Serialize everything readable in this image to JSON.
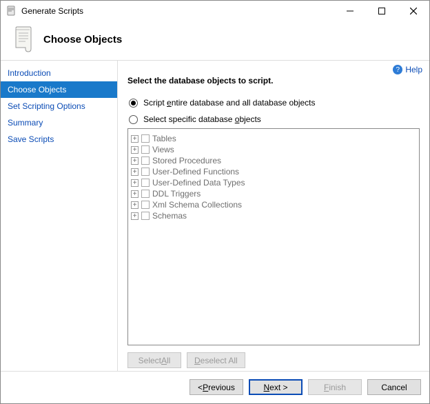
{
  "window": {
    "title": "Generate Scripts"
  },
  "header": {
    "title": "Choose Objects"
  },
  "sidebar": {
    "items": [
      {
        "label": "Introduction"
      },
      {
        "label": "Choose Objects"
      },
      {
        "label": "Set Scripting Options"
      },
      {
        "label": "Summary"
      },
      {
        "label": "Save Scripts"
      }
    ],
    "active_index": 1
  },
  "help": {
    "label": "Help"
  },
  "main": {
    "instruction": "Select the database objects to script.",
    "radios": {
      "entire_pre": "Script ",
      "entire_u": "e",
      "entire_post": "ntire database and all database objects",
      "specific_pre": "Select specific database ",
      "specific_u": "o",
      "specific_post": "bjects",
      "selected": "entire"
    },
    "tree": [
      "Tables",
      "Views",
      "Stored Procedures",
      "User-Defined Functions",
      "User-Defined Data Types",
      "DDL Triggers",
      "Xml Schema Collections",
      "Schemas"
    ],
    "select_all_pre": "Select ",
    "select_all_u": "A",
    "select_all_post": "ll",
    "deselect_all_pre": "",
    "deselect_all_u": "D",
    "deselect_all_post": "eselect All"
  },
  "footer": {
    "prev_pre": "< ",
    "prev_u": "P",
    "prev_post": "revious",
    "next_u": "N",
    "next_post": "ext >",
    "finish_u": "F",
    "finish_post": "inish",
    "cancel": "Cancel"
  }
}
